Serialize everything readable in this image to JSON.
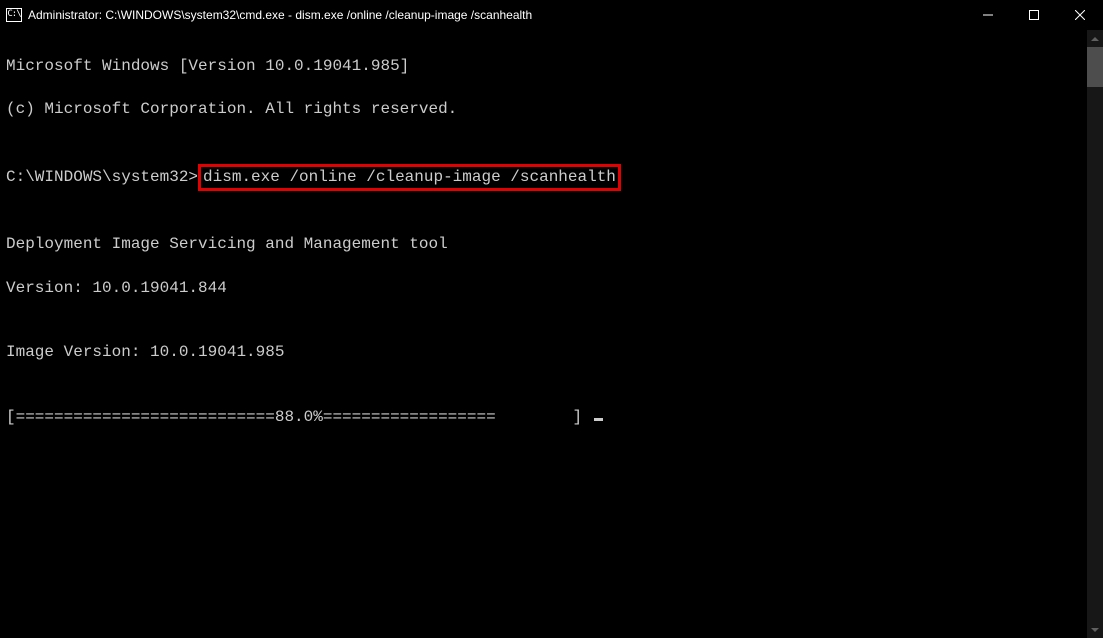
{
  "titlebar": {
    "icon_text": "C:\\",
    "title": "Administrator: C:\\WINDOWS\\system32\\cmd.exe - dism.exe  /online /cleanup-image /scanhealth"
  },
  "terminal": {
    "line1": "Microsoft Windows [Version 10.0.19041.985]",
    "line2": "(c) Microsoft Corporation. All rights reserved.",
    "blank1": "",
    "prompt_prefix": "C:\\WINDOWS\\system32>",
    "command_highlighted": "dism.exe /online /cleanup-image /scanhealth",
    "blank2": "",
    "tool_line": "Deployment Image Servicing and Management tool",
    "tool_version": "Version: 10.0.19041.844",
    "blank3": "",
    "image_version": "Image Version: 10.0.19041.985",
    "blank4": "",
    "progress": "[===========================88.0%==================        ] "
  }
}
